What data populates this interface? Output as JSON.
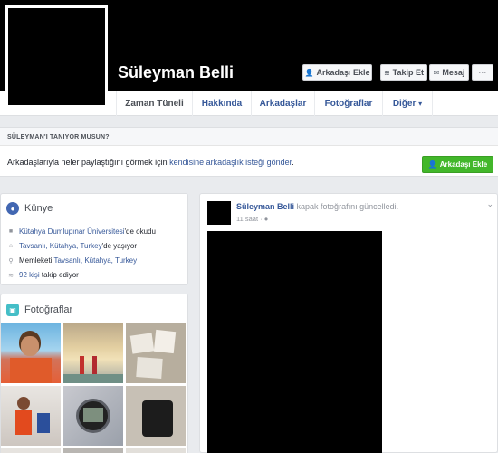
{
  "profile": {
    "name": "Süleyman Belli"
  },
  "cover_buttons": {
    "add_friend": {
      "label": "Arkadaşı Ekle",
      "icon": "add-friend-icon"
    },
    "follow": {
      "label": "Takip Et",
      "icon": "rss-icon"
    },
    "message": {
      "label": "Mesaj",
      "icon": "message-icon"
    },
    "more": {
      "label": "···"
    }
  },
  "nav": {
    "tabs": [
      "Zaman Tüneli",
      "Hakkında",
      "Arkadaşlar",
      "Fotoğraflar"
    ],
    "more_label": "Diğer",
    "more_arrow": "▾"
  },
  "know_you": {
    "title": "SÜLEYMAN'I TANIYOR MUSUN?",
    "text_before": "Arkadaşlarıyla neler paylaştığını görmek için ",
    "link": "kendisine arkadaşlık isteği gönder",
    "text_after": ".",
    "button": "Arkadaşı Ekle"
  },
  "intro": {
    "title": "Künye",
    "items": [
      {
        "icon": "school-icon",
        "link": "Kütahya Dumlupınar Üniversitesi",
        "suffix": "'de okudu"
      },
      {
        "icon": "home-icon",
        "link": "Tavsanlı, Kütahya, Turkey",
        "suffix": "'de yaşıyor"
      },
      {
        "icon": "location-pin-icon",
        "prefix": "Memleketi ",
        "link": "Tavsanlı, Kütahya, Turkey"
      },
      {
        "icon": "rss-icon",
        "link": "92 kişi",
        "suffix": " takip ediyor"
      }
    ]
  },
  "photos": {
    "title": "Fotoğraflar"
  },
  "post": {
    "author": "Süleyman Belli",
    "action": " kapak fotoğrafını güncelledi.",
    "time": "11 saat",
    "dot": " · ",
    "chevron": "⌄"
  },
  "colors": {
    "link": "#365899",
    "green": "#42b72a",
    "bg": "#e9ebee"
  }
}
